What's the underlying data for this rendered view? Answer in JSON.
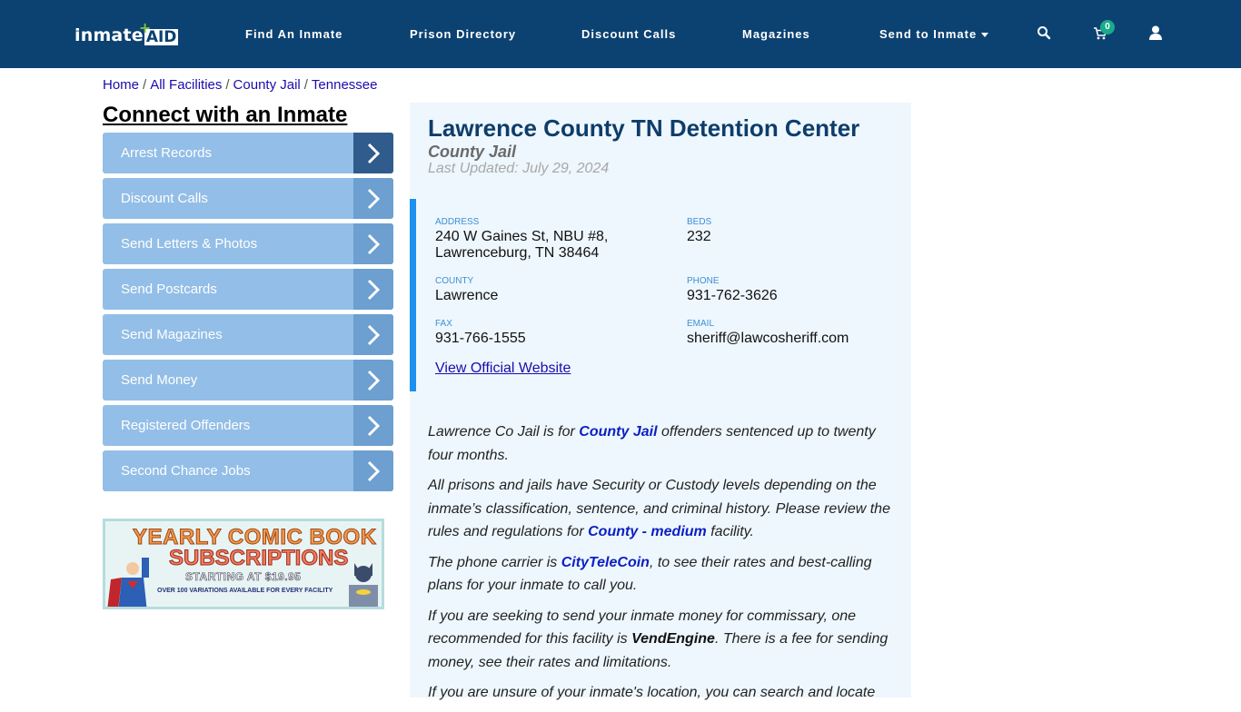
{
  "navbar": {
    "logo": {
      "part1": "inmate",
      "part2": "AID"
    },
    "items": [
      "Find An Inmate",
      "Prison Directory",
      "Discount Calls",
      "Magazines",
      "Send to Inmate"
    ],
    "cart_count": "0",
    "icons": [
      "search-icon",
      "cart-icon",
      "user-icon"
    ]
  },
  "breadcrumb": [
    "Home",
    "All Facilities",
    "County Jail",
    "Tennessee"
  ],
  "sidebar": {
    "title": "Connect with an Inmate",
    "items": [
      "Arrest Records",
      "Discount Calls",
      "Send Letters & Photos",
      "Send Postcards",
      "Send Magazines",
      "Send Money",
      "Registered Offenders",
      "Second Chance Jobs"
    ],
    "banner": {
      "line1": "YEARLY COMIC BOOK",
      "line2": "SUBSCRIPTIONS",
      "line3": "STARTING AT $19.95",
      "line4": "OVER 100 VARIATIONS AVAILABLE FOR EVERY FACILITY"
    }
  },
  "facility": {
    "name": "Lawrence County TN Detention Center",
    "type": "County Jail",
    "last_updated": "Last Updated: July 29, 2024",
    "address_label": "ADDRESS",
    "address_line1": "240 W Gaines St, NBU #8,",
    "address_line2": "Lawrenceburg, TN 38464",
    "beds_label": "BEDS",
    "beds": "232",
    "county_label": "COUNTY",
    "county": "Lawrence",
    "phone_label": "PHONE",
    "phone": "931-762-3626",
    "fax_label": "FAX",
    "fax": "931-766-1555",
    "email_label": "EMAIL",
    "email": "sheriff@lawcosheriff.com",
    "website_link": "View Official Website"
  },
  "description": {
    "p1_a": "Lawrence Co Jail is for ",
    "p1_link": "County Jail",
    "p1_b": " offenders sentenced up to twenty four months.",
    "p2_a": "All prisons and jails have Security or Custody levels depending on the inmate’s classification, sentence, and criminal history. Please review the rules and regulations for ",
    "p2_link": "County - medium",
    "p2_b": " facility.",
    "p3_a": "The phone carrier is ",
    "p3_link": "CityTeleCoin",
    "p3_b": ", to see their rates and best-calling plans for your inmate to call you.",
    "p4_a": "If you are seeking to send your inmate money for commissary, one recommended for this facility is ",
    "p4_bold": "VendEngine",
    "p4_b": ". There is a fee for sending money, see their rates and limitations.",
    "p5": "If you are unsure of your inmate's location, you can search and locate"
  }
}
